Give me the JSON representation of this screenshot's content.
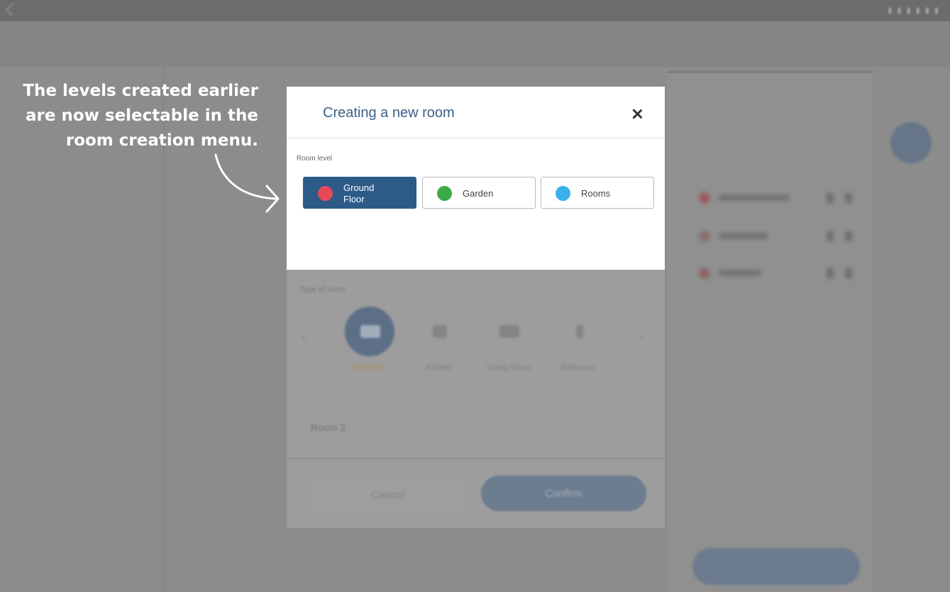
{
  "annotation": {
    "line1": "The levels created earlier",
    "line2": "are now selectable in the",
    "line3": "room creation menu."
  },
  "dialog": {
    "title": "Creating a new room",
    "room_level_label": "Room level",
    "levels": [
      {
        "line1": "Ground",
        "line2": "Floor",
        "color": "#e8495a",
        "selected": true
      },
      {
        "line1": "Garden",
        "line2": "",
        "color": "#3daa4a",
        "selected": false
      },
      {
        "line1": "Rooms",
        "line2": "",
        "color": "#3ab0e8",
        "selected": false
      }
    ]
  },
  "colors": {
    "selected_level_bg": "#2d5b88",
    "title": "#3d5f86"
  }
}
